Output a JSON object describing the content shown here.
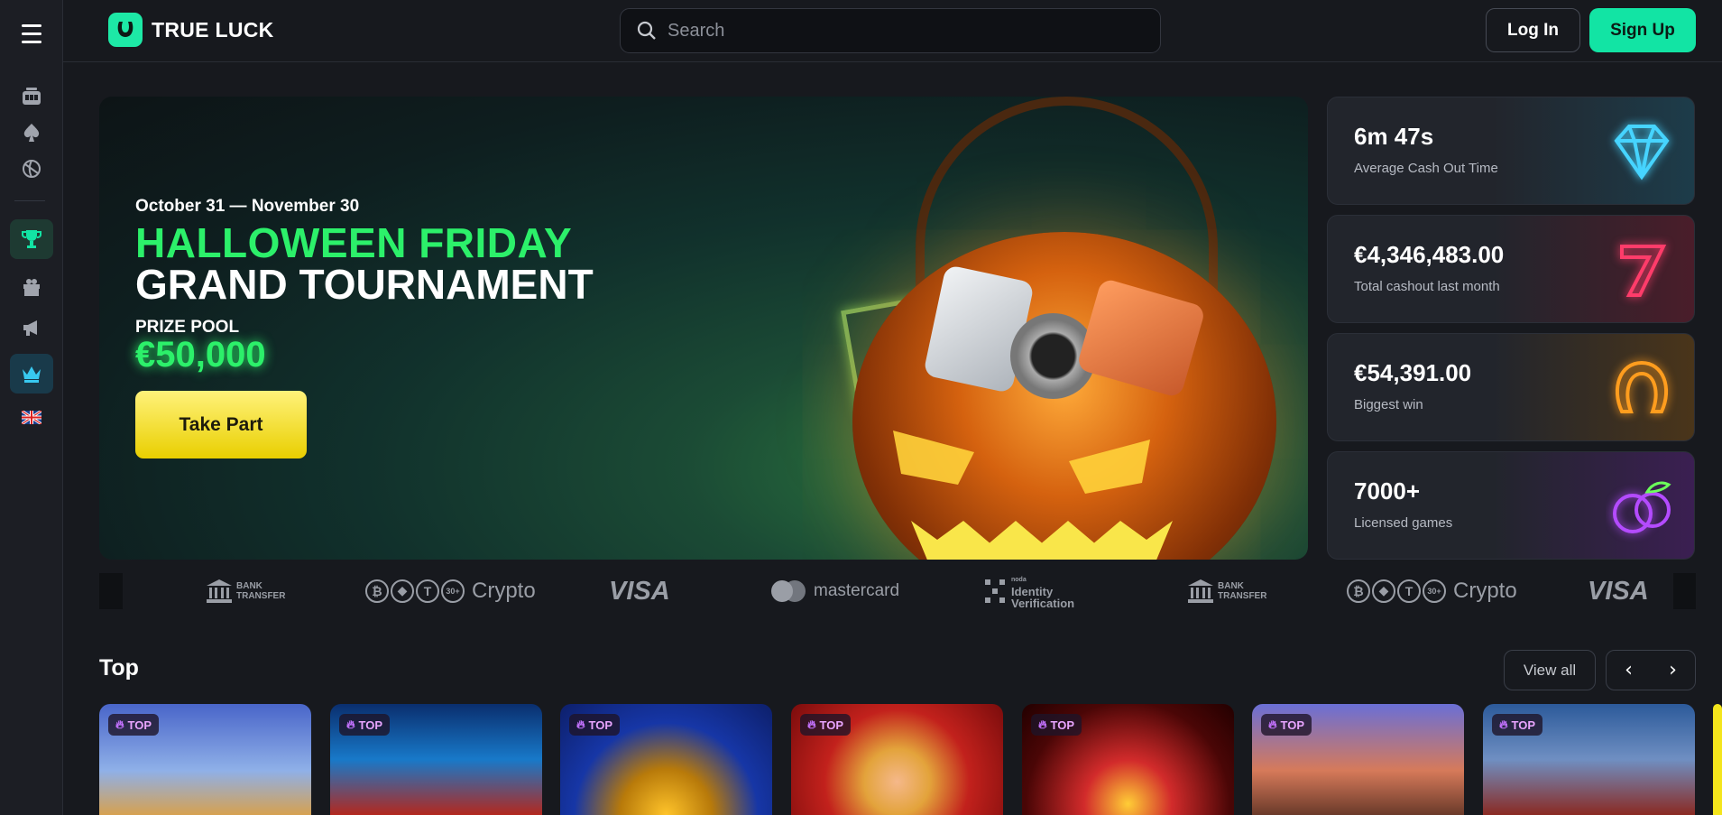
{
  "brand": {
    "name": "TRUE LUCK",
    "accent": "#12e4a4"
  },
  "search": {
    "placeholder": "Search"
  },
  "auth": {
    "login_label": "Log In",
    "signup_label": "Sign Up"
  },
  "sidebar": {
    "items": [
      {
        "icon": "menu-icon"
      },
      {
        "icon": "slot-machine-icon"
      },
      {
        "icon": "spade-icon"
      },
      {
        "icon": "sports-ball-icon"
      },
      {
        "icon": "trophy-icon"
      },
      {
        "icon": "gift-icon"
      },
      {
        "icon": "megaphone-icon"
      },
      {
        "icon": "crown-icon"
      },
      {
        "icon": "uk-flag-icon"
      }
    ]
  },
  "hero": {
    "date": "October 31 — November 30",
    "title_line1": "HALLOWEEN FRIDAY",
    "title_line2": "GRAND TOURNAMENT",
    "prize_label": "PRIZE POOL",
    "prize_amount": "€50,000",
    "cta": "Take Part"
  },
  "stats": [
    {
      "value": "6m 47s",
      "label": "Average Cash Out Time",
      "icon": "diamond-icon"
    },
    {
      "value": "€4,346,483.00",
      "label": "Total cashout last month",
      "icon": "seven-icon"
    },
    {
      "value": "€54,391.00",
      "label": "Biggest win",
      "icon": "horseshoe-icon"
    },
    {
      "value": "7000+",
      "label": "Licensed games",
      "icon": "plum-icon"
    }
  ],
  "payments": {
    "bank_line1": "BANK",
    "bank_line2": "TRANSFER",
    "crypto": "Crypto",
    "crypto_count": "30+",
    "visa": "VISA",
    "mastercard": "mastercard",
    "noda_small": "noda",
    "noda_line1": "Identity",
    "noda_line2": "Verification"
  },
  "top_section": {
    "title": "Top",
    "view_all": "View all",
    "prev": "‹",
    "next": "›",
    "tag": "TOP"
  }
}
